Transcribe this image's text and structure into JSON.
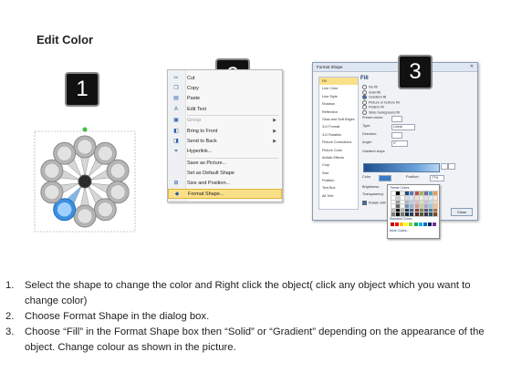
{
  "page_title": "Edit Color",
  "step_numbers": [
    "1",
    "2",
    "3"
  ],
  "context_menu": {
    "items": [
      {
        "label": "Cut",
        "icon": "scissors-icon",
        "glyph": "✂",
        "disabled": false,
        "submenu": false
      },
      {
        "label": "Copy",
        "icon": "copy-icon",
        "glyph": "❐",
        "disabled": false,
        "submenu": false
      },
      {
        "label": "Paste",
        "icon": "paste-icon",
        "glyph": "▤",
        "disabled": false,
        "submenu": false
      },
      {
        "label": "Edit Text",
        "icon": "edit-text-icon",
        "glyph": "A",
        "disabled": false,
        "submenu": false
      },
      {
        "label": "Group",
        "icon": "group-icon",
        "glyph": "▣",
        "disabled": true,
        "submenu": true
      },
      {
        "label": "Bring to Front",
        "icon": "bring-front-icon",
        "glyph": "◧",
        "disabled": false,
        "submenu": true
      },
      {
        "label": "Send to Back",
        "icon": "send-back-icon",
        "glyph": "◨",
        "disabled": false,
        "submenu": true
      },
      {
        "label": "Hyperlink...",
        "icon": "hyperlink-icon",
        "glyph": "⚭",
        "disabled": false,
        "submenu": false
      },
      {
        "label": "Save as Picture...",
        "icon": "",
        "glyph": "",
        "disabled": false,
        "submenu": false
      },
      {
        "label": "Set as Default Shape",
        "icon": "",
        "glyph": "",
        "disabled": false,
        "submenu": false
      },
      {
        "label": "Size and Position...",
        "icon": "size-position-icon",
        "glyph": "⊞",
        "disabled": false,
        "submenu": false
      },
      {
        "label": "Format Shape...",
        "icon": "format-shape-icon",
        "glyph": "◆",
        "disabled": false,
        "submenu": false,
        "highlighted": true
      }
    ]
  },
  "format_dialog": {
    "title": "Format Shape",
    "close_glyph": "✕",
    "categories": [
      "Fill",
      "Line Color",
      "Line Style",
      "Shadow",
      "Reflection",
      "Glow and Soft Edges",
      "3-D Format",
      "3-D Rotation",
      "Picture Corrections",
      "Picture Color",
      "Artistic Effects",
      "Crop",
      "Size",
      "Position",
      "Text Box",
      "Alt Text"
    ],
    "selected_category": "Fill",
    "fill_heading": "Fill",
    "fill_options": [
      "No fill",
      "Solid fill",
      "Gradient fill",
      "Picture or texture fill",
      "Pattern fill",
      "Slide background fill"
    ],
    "selected_fill_option": "Gradient fill",
    "preset_label": "Preset colors:",
    "type_label": "Type:",
    "type_value": "Linear",
    "direction_label": "Direction:",
    "angle_label": "Angle:",
    "angle_value": "0°",
    "gradient_stops_label": "Gradient stops",
    "color_label": "Color",
    "position_label": "Position:",
    "position_value": "77%",
    "brightness_label": "Brightness:",
    "transparency_label": "Transparency:",
    "rotate_label": "Rotate with shape",
    "theme_colors_label": "Theme Colors",
    "standard_colors_label": "Standard Colors",
    "more_colors_label": "More Colors...",
    "close_button": "Close"
  },
  "instructions": [
    {
      "num": "1.",
      "text": "Select the shape to change the color and Right click the object( click any object which you want to change color)"
    },
    {
      "num": "2.",
      "text": "Choose Format Shape in the dialog box."
    },
    {
      "num": "3.",
      "text": "Choose “Fill” in the Format Shape box then “Solid” or “Gradient” depending on the appearance of the object. Change colour as shown in the picture."
    }
  ],
  "colors": {
    "petal_gray": "#b5b5b5",
    "petal_selected": "#3b8fe0",
    "hub": "#2b2b2b",
    "menu_highlight": "#fbe08a",
    "gradient_start": "#1c4f8f"
  }
}
